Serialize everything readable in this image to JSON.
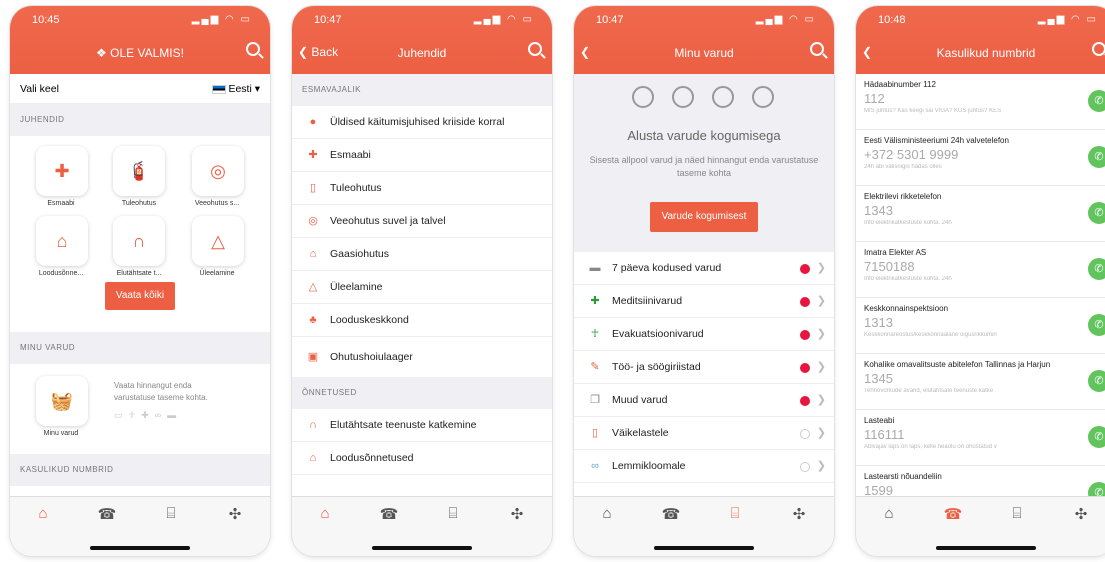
{
  "phone1": {
    "time": "10:45",
    "title": "OLE VALMIS!",
    "language_label": "Vali keel",
    "language_value": "Eesti",
    "section_guides": "JUHENDID",
    "tiles": [
      "Esmaabi",
      "Tuleohutus",
      "Veeohutus s...",
      "Loodusõnne...",
      "Elutähtsate t...",
      "Üleelamine"
    ],
    "see_all": "Vaata kõiki",
    "section_supplies": "MINU VARUD",
    "supplies_tile": "Minu varud",
    "supplies_text": "Vaata hinnangut enda varustatuse taseme kohta.",
    "section_numbers": "KASULIKUD NUMBRID"
  },
  "phone2": {
    "time": "10:47",
    "back": "Back",
    "title": "Juhendid",
    "section_primer": "ESMAVAJALIK",
    "primer_items": [
      "Üldised käitumisjuhised kriiside korral",
      "Esmaabi",
      "Tuleohutus",
      "Veeohutus suvel ja talvel",
      "Gaasiohutus",
      "Üleelamine",
      "Looduskeskkond",
      "Ohutushoiulaager"
    ],
    "section_accidents": "ÕNNETUSED",
    "accident_items": [
      "Elutähtsate teenuste katkemine",
      "Loodusõnnetused"
    ]
  },
  "phone3": {
    "time": "10:47",
    "title": "Minu varud",
    "start_title": "Alusta varude kogumisega",
    "start_text": "Sisesta allpool varud ja näed hinnangut enda varustatuse taseme kohta",
    "button": "Varude kogumisest",
    "items": [
      {
        "label": "7 päeva kodused varud",
        "status": "red"
      },
      {
        "label": "Meditsiinivarud",
        "status": "red"
      },
      {
        "label": "Evakuatsioonivarud",
        "status": "red"
      },
      {
        "label": "Töö- ja söögiriistad",
        "status": "red"
      },
      {
        "label": "Muud varud",
        "status": "red"
      },
      {
        "label": "Väikelastele",
        "status": "empty"
      },
      {
        "label": "Lemmikloomale",
        "status": "empty"
      }
    ]
  },
  "phone4": {
    "time": "10:48",
    "title": "Kasulikud numbrid",
    "numbers": [
      {
        "title": "Hädaabinumber 112",
        "value": "112",
        "note": "MIS juhtus? Kas keegi sai VIGA? KUS juhtus? KES"
      },
      {
        "title": "Eesti Välisministeeriumi 24h valvetelefon",
        "value": "+372 5301 9999",
        "note": "24h abi välisriigis hädas olles"
      },
      {
        "title": "Elektrilevi rikketelefon",
        "value": "1343",
        "note": "Info elektrikatkestuste kohta. 24h"
      },
      {
        "title": "Imatra Elekter AS",
        "value": "7150188",
        "note": "Info elektrikatkestuste kohta. 24h"
      },
      {
        "title": "Keskkonnainspektsioon",
        "value": "1313",
        "note": "Keskkonnareostus/keskkonnaalane õigusrikkumin"
      },
      {
        "title": "Kohalike omavalitsuste abitelefon Tallinnas ja Harjun",
        "value": "1345",
        "note": "Tehnovõrkude avarid, elutähtsate teenuste katke"
      },
      {
        "title": "Lasteabi",
        "value": "116111",
        "note": "Abivajav laps on laps, kelle heaolu on ohustatud v"
      },
      {
        "title": "Lastearsti nõuandeliin",
        "value": "1599",
        "note": ""
      }
    ]
  }
}
